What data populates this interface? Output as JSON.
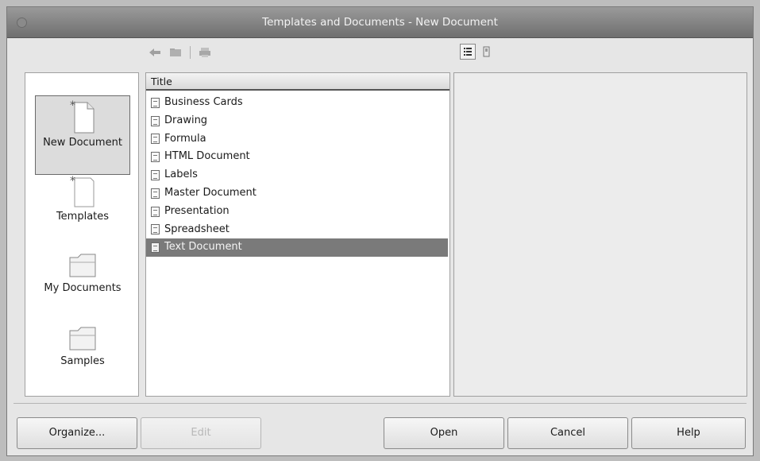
{
  "window": {
    "title": "Templates and Documents - New Document"
  },
  "toolbar": {
    "back_icon": "back-arrow-icon",
    "home_icon": "folder-up-icon",
    "print_icon": "print-icon",
    "view_details_icon": "document-details-icon",
    "view_preview_icon": "document-preview-icon"
  },
  "nav": {
    "items": [
      {
        "label": "New Document",
        "icon": "new-document-icon",
        "active": true
      },
      {
        "label": "Templates",
        "icon": "templates-icon",
        "active": false
      },
      {
        "label": "My Documents",
        "icon": "folder-icon",
        "active": false
      },
      {
        "label": "Samples",
        "icon": "folder-icon",
        "active": false
      }
    ]
  },
  "list": {
    "column_header": "Title",
    "rows": [
      "Business Cards",
      "Drawing",
      "Formula",
      "HTML Document",
      "Labels",
      "Master Document",
      "Presentation",
      "Spreadsheet",
      "Text Document"
    ],
    "selected_row": "Text Document"
  },
  "buttons": {
    "organize": "Organize...",
    "edit": "Edit",
    "open": "Open",
    "cancel": "Cancel",
    "help": "Help"
  },
  "colors": {
    "selection": "#7a7a7a",
    "titlebar": "#7d7d7d"
  }
}
